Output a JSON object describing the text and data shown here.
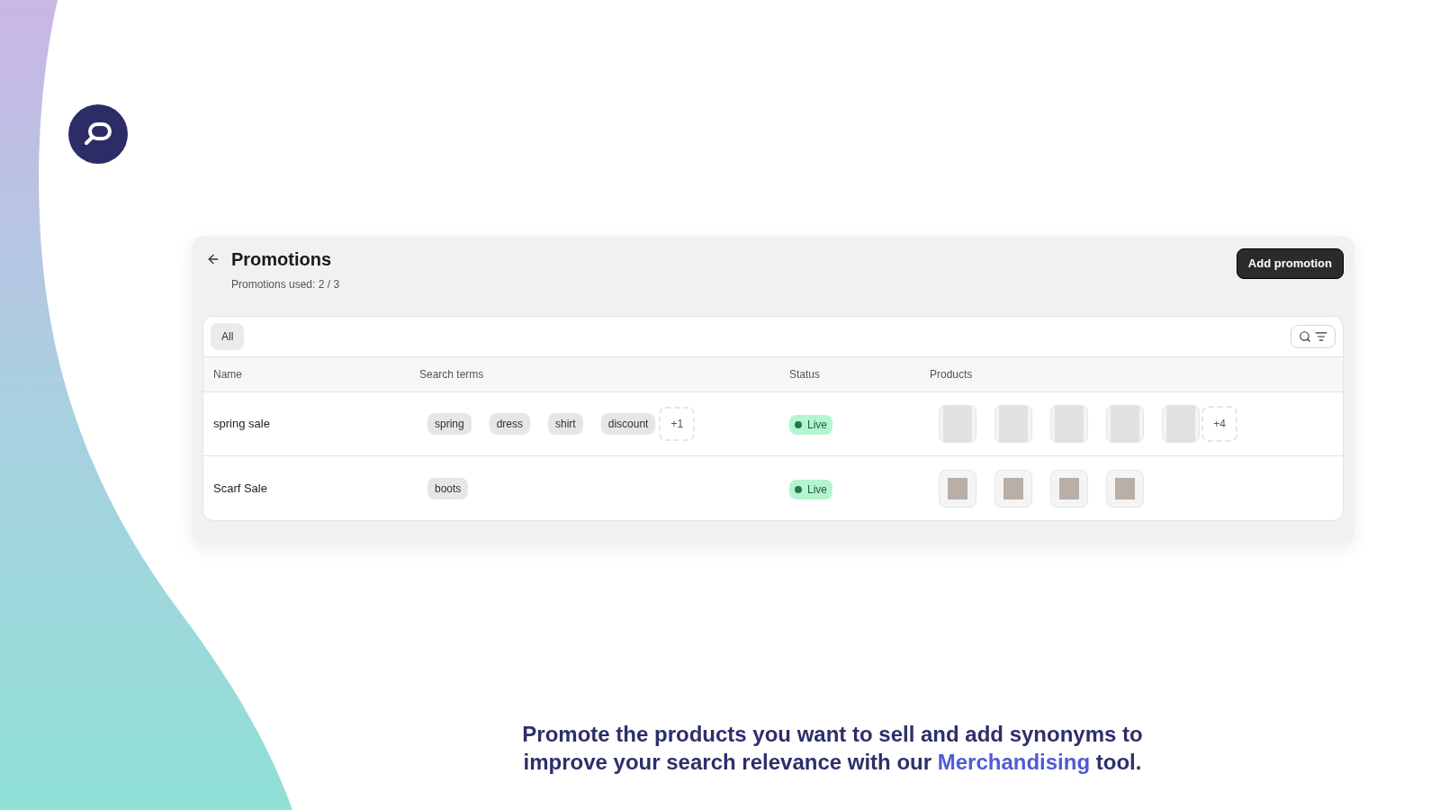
{
  "header": {
    "title": "Promotions",
    "subtitle": "Promotions used: 2 / 3",
    "action": "Add promotion"
  },
  "filters": [
    {
      "label": "All",
      "selected": true
    }
  ],
  "table": {
    "columns": [
      "Name",
      "Search terms",
      "Status",
      "Products"
    ],
    "rows": [
      {
        "name": "spring sale",
        "terms": [
          "spring",
          "dress",
          "shirt",
          "discount"
        ],
        "more_terms": "+1",
        "status": {
          "label": "Live",
          "kind": "live"
        },
        "products": [
          {
            "kind": "model"
          },
          {
            "kind": "model"
          },
          {
            "kind": "model"
          },
          {
            "kind": "model"
          },
          {
            "kind": "model"
          }
        ],
        "more_products": "+4"
      },
      {
        "name": "Scarf Sale",
        "terms": [
          "boots"
        ],
        "status": {
          "label": "Live",
          "kind": "live"
        },
        "products": [
          {
            "kind": "scarf"
          },
          {
            "kind": "scarf"
          },
          {
            "kind": "scarf"
          },
          {
            "kind": "scarf"
          }
        ]
      }
    ]
  },
  "caption": {
    "before": "Promote the products you want to sell and add synonyms to improve your search relevance with our",
    "link": "Merchandising",
    "after": "tool."
  }
}
